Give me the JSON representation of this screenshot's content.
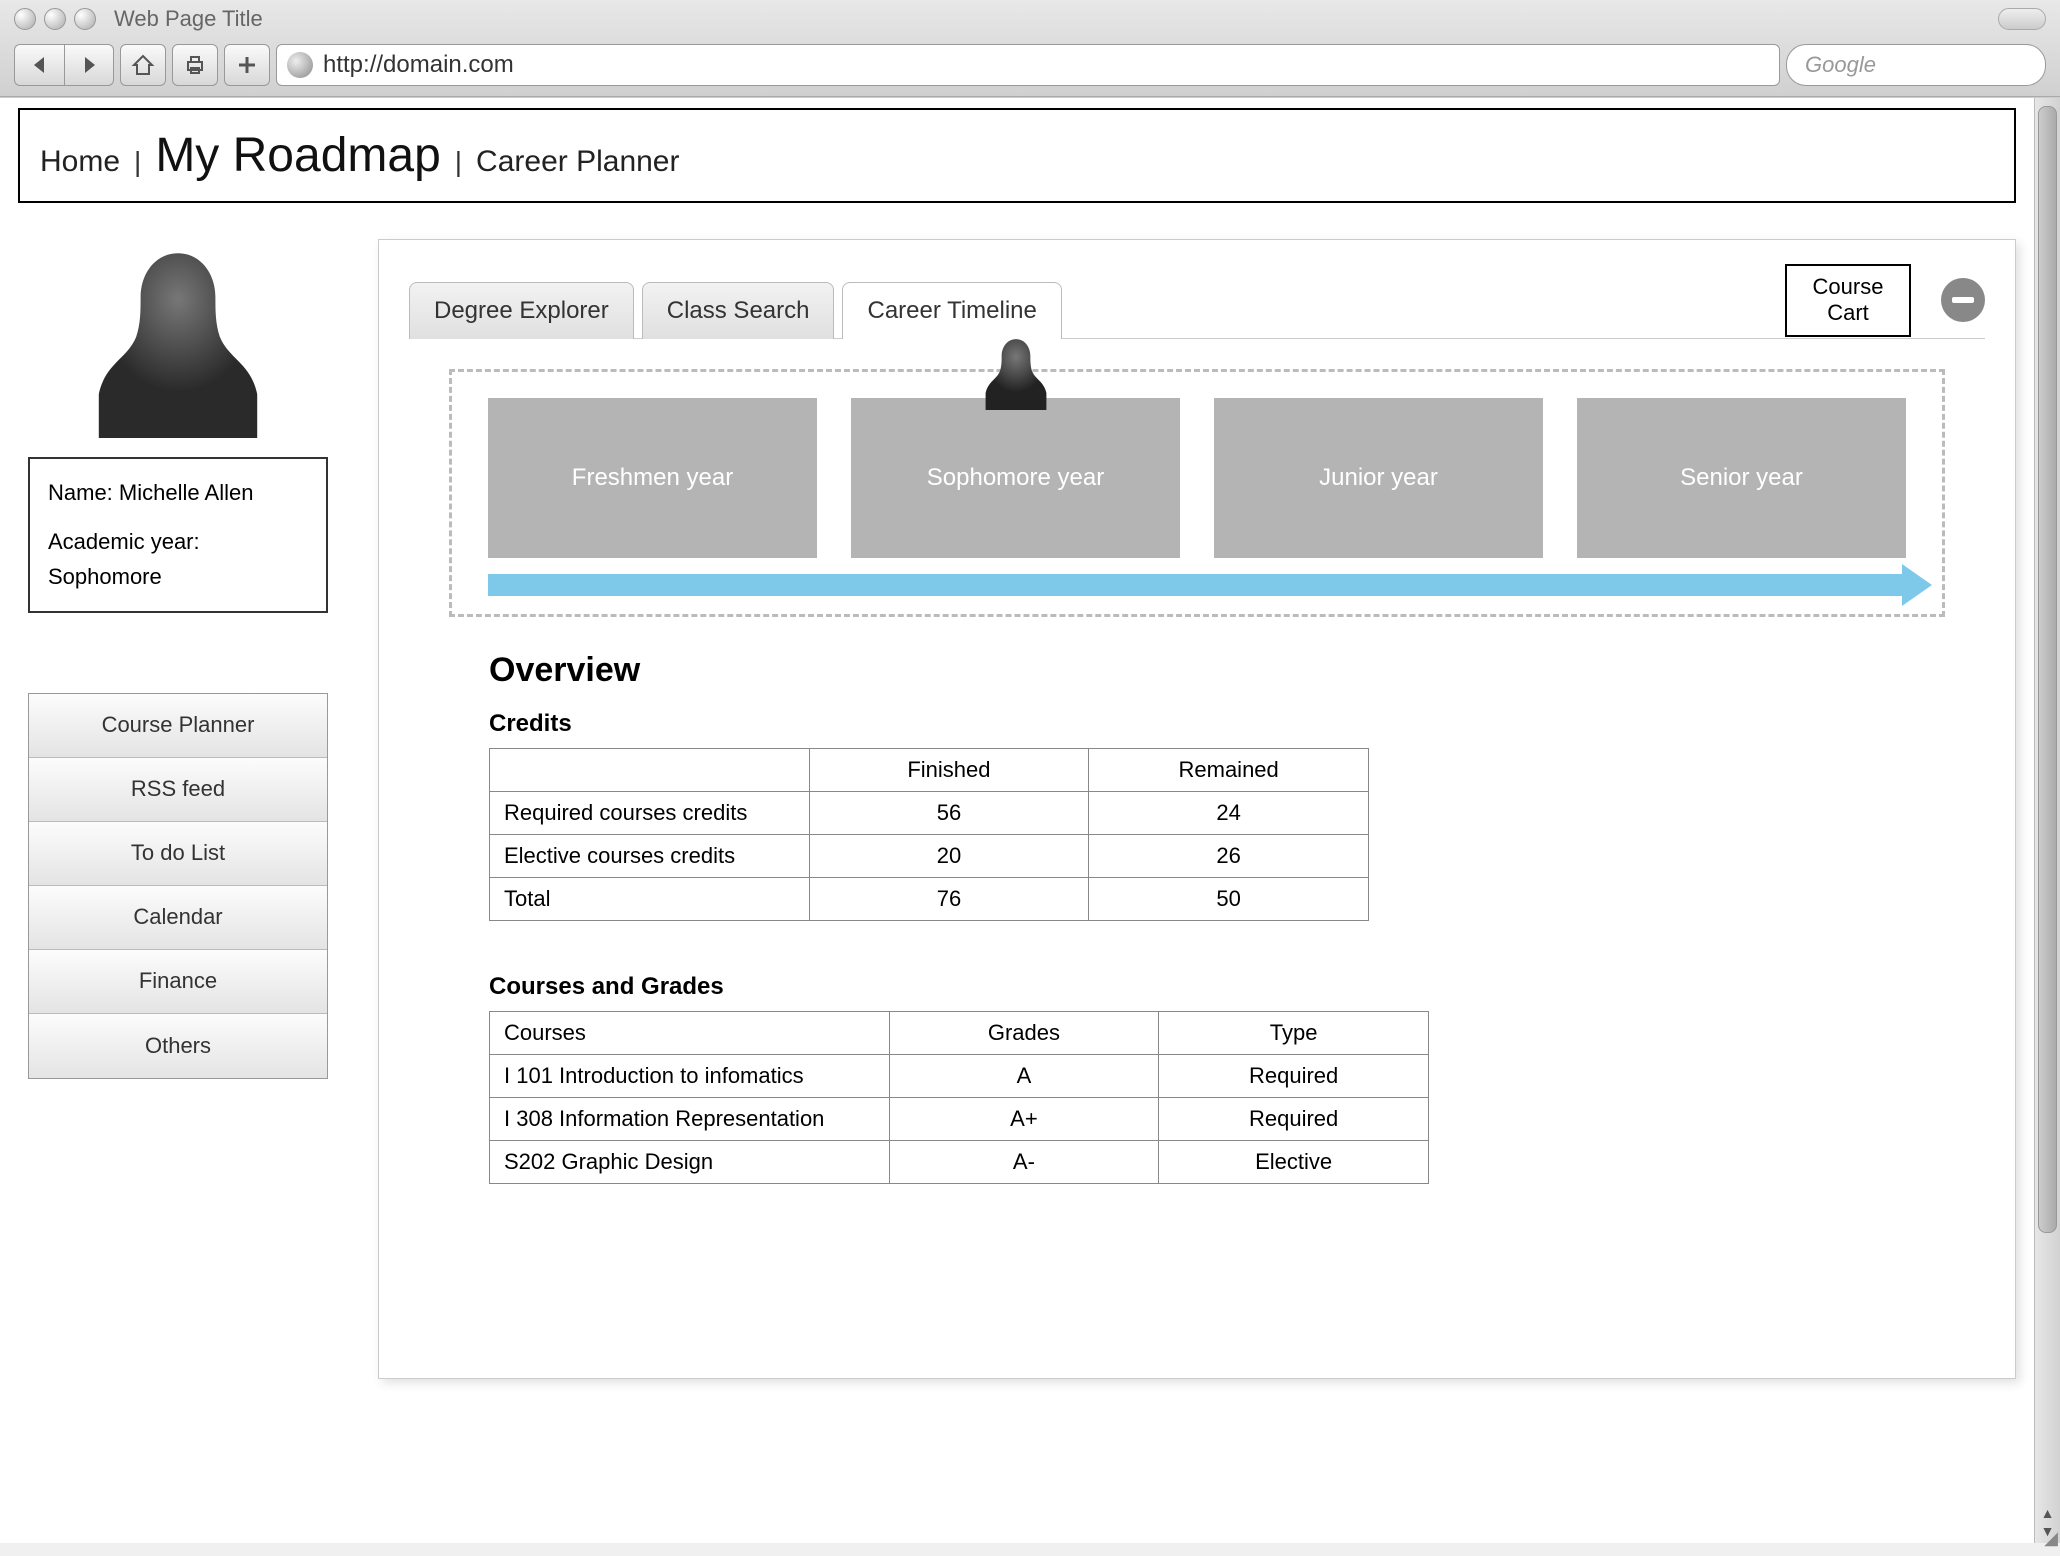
{
  "browser": {
    "title": "Web Page Title",
    "url": "http://domain.com",
    "search_placeholder": "Google"
  },
  "breadcrumb": {
    "items": [
      "Home",
      "My Roadmap",
      "Career Planner"
    ],
    "active_index": 1
  },
  "profile": {
    "name_label": "Name:",
    "name": "Michelle Allen",
    "year_label": "Academic year:",
    "year": "Sophomore"
  },
  "side_menu": {
    "items": [
      "Course Planner",
      "RSS feed",
      "To do List",
      "Calendar",
      "Finance",
      "Others"
    ]
  },
  "panel": {
    "tabs": [
      "Degree  Explorer",
      "Class Search",
      "Career Timeline"
    ],
    "active_tab_index": 2,
    "course_cart_label": "Course Cart"
  },
  "timeline": {
    "years": [
      "Freshmen year",
      "Sophomore year",
      "Junior year",
      "Senior year"
    ],
    "current_index": 1
  },
  "overview": {
    "heading": "Overview",
    "credits_heading": "Credits",
    "credits_table": {
      "columns": [
        "",
        "Finished",
        "Remained"
      ],
      "rows": [
        [
          "Required courses credits",
          "56",
          "24"
        ],
        [
          "Elective courses credits",
          "20",
          "26"
        ],
        [
          "Total",
          "76",
          "50"
        ]
      ]
    },
    "courses_heading": "Courses and Grades",
    "courses_table": {
      "columns": [
        "Courses",
        "Grades",
        "Type"
      ],
      "rows": [
        [
          "I 101 Introduction to infomatics",
          "A",
          "Required"
        ],
        [
          "I 308 Information Representation",
          "A+",
          "Required"
        ],
        [
          "S202 Graphic Design",
          "A-",
          "Elective"
        ]
      ]
    }
  }
}
